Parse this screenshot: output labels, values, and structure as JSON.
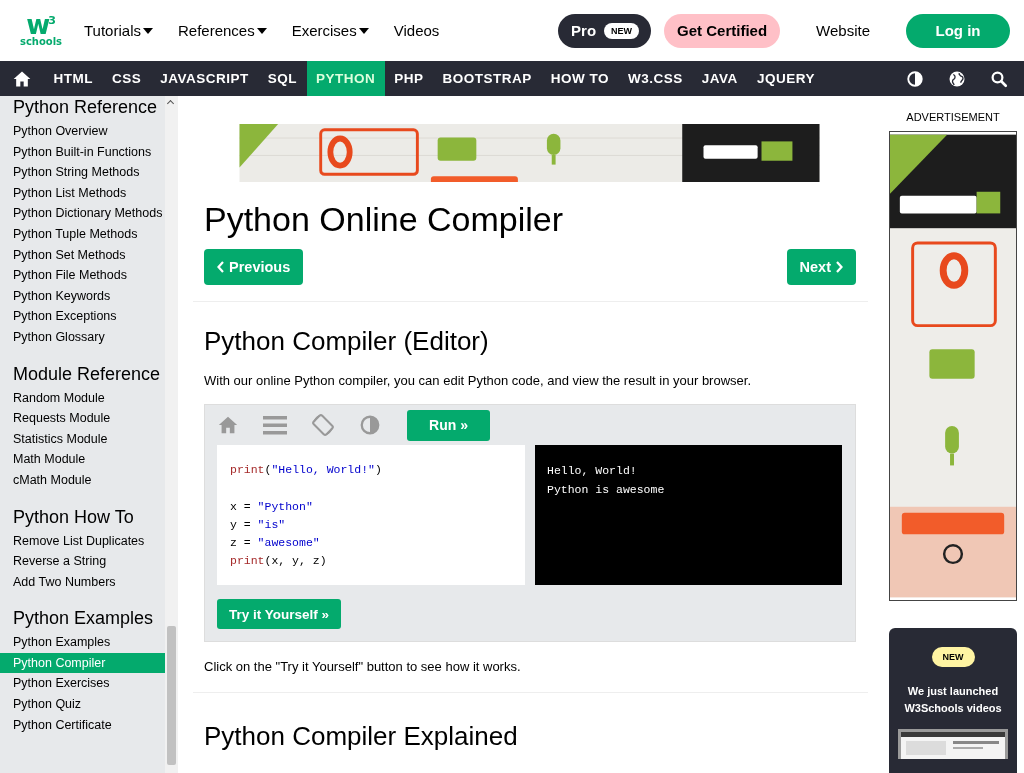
{
  "header": {
    "logo": {
      "mark": "w",
      "sup": "3",
      "text": "schools"
    },
    "menus": [
      {
        "label": "Tutorials",
        "dropdown": true
      },
      {
        "label": "References",
        "dropdown": true
      },
      {
        "label": "Exercises",
        "dropdown": true
      },
      {
        "label": "Videos",
        "dropdown": false
      }
    ],
    "pro": {
      "label": "Pro",
      "badge": "NEW"
    },
    "certified": "Get Certified",
    "website": "Website",
    "login": "Log in"
  },
  "nav": {
    "items": [
      {
        "label": "HTML",
        "selected": false
      },
      {
        "label": "CSS",
        "selected": false
      },
      {
        "label": "JAVASCRIPT",
        "selected": false
      },
      {
        "label": "SQL",
        "selected": false
      },
      {
        "label": "PYTHON",
        "selected": true
      },
      {
        "label": "PHP",
        "selected": false
      },
      {
        "label": "BOOTSTRAP",
        "selected": false
      },
      {
        "label": "HOW TO",
        "selected": false
      },
      {
        "label": "W3.CSS",
        "selected": false
      },
      {
        "label": "JAVA",
        "selected": false
      },
      {
        "label": "JQUERY",
        "selected": false
      }
    ]
  },
  "sidebar": {
    "sections": [
      {
        "heading": "Python Reference",
        "items": [
          {
            "label": "Python Overview",
            "selected": false
          },
          {
            "label": "Python Built-in Functions",
            "selected": false
          },
          {
            "label": "Python String Methods",
            "selected": false
          },
          {
            "label": "Python List Methods",
            "selected": false
          },
          {
            "label": "Python Dictionary Methods",
            "selected": false
          },
          {
            "label": "Python Tuple Methods",
            "selected": false
          },
          {
            "label": "Python Set Methods",
            "selected": false
          },
          {
            "label": "Python File Methods",
            "selected": false
          },
          {
            "label": "Python Keywords",
            "selected": false
          },
          {
            "label": "Python Exceptions",
            "selected": false
          },
          {
            "label": "Python Glossary",
            "selected": false
          }
        ]
      },
      {
        "heading": "Module Reference",
        "items": [
          {
            "label": "Random Module",
            "selected": false
          },
          {
            "label": "Requests Module",
            "selected": false
          },
          {
            "label": "Statistics Module",
            "selected": false
          },
          {
            "label": "Math Module",
            "selected": false
          },
          {
            "label": "cMath Module",
            "selected": false
          }
        ]
      },
      {
        "heading": "Python How To",
        "items": [
          {
            "label": "Remove List Duplicates",
            "selected": false
          },
          {
            "label": "Reverse a String",
            "selected": false
          },
          {
            "label": "Add Two Numbers",
            "selected": false
          }
        ]
      },
      {
        "heading": "Python Examples",
        "items": [
          {
            "label": "Python Examples",
            "selected": false
          },
          {
            "label": "Python Compiler",
            "selected": true
          },
          {
            "label": "Python Exercises",
            "selected": false
          },
          {
            "label": "Python Quiz",
            "selected": false
          },
          {
            "label": "Python Certificate",
            "selected": false
          }
        ]
      }
    ]
  },
  "main": {
    "title": "Python Online Compiler",
    "previous": "Previous",
    "next": "Next",
    "section_heading": "Python Compiler (Editor)",
    "intro": "With our online Python compiler, you can edit Python code, and view the result in your browser.",
    "editor": {
      "run": "Run »",
      "code": [
        {
          "kind": "code",
          "tokens": [
            {
              "kind": "fn",
              "text": "print"
            },
            {
              "kind": "plain",
              "text": "("
            },
            {
              "kind": "str",
              "text": "\"Hello, World!\""
            },
            {
              "kind": "plain",
              "text": ")"
            }
          ]
        },
        {
          "kind": "blank"
        },
        {
          "kind": "code",
          "tokens": [
            {
              "kind": "plain",
              "text": "x = "
            },
            {
              "kind": "str",
              "text": "\"Python\""
            }
          ]
        },
        {
          "kind": "code",
          "tokens": [
            {
              "kind": "plain",
              "text": "y = "
            },
            {
              "kind": "str",
              "text": "\"is\""
            }
          ]
        },
        {
          "kind": "code",
          "tokens": [
            {
              "kind": "plain",
              "text": "z = "
            },
            {
              "kind": "str",
              "text": "\"awesome\""
            }
          ]
        },
        {
          "kind": "code",
          "tokens": [
            {
              "kind": "fn",
              "text": "print"
            },
            {
              "kind": "plain",
              "text": "(x, y, z)"
            }
          ]
        }
      ],
      "output": [
        "Hello, World!",
        "Python is awesome"
      ],
      "try": "Try it Yourself »"
    },
    "note": "Click on the \"Try it Yourself\" button to see how it works.",
    "heading2": "Python Compiler Explained"
  },
  "right": {
    "ad_label": "ADVERTISEMENT",
    "video_card": {
      "badge": "NEW",
      "text": "We just launched W3Schools videos"
    }
  }
}
